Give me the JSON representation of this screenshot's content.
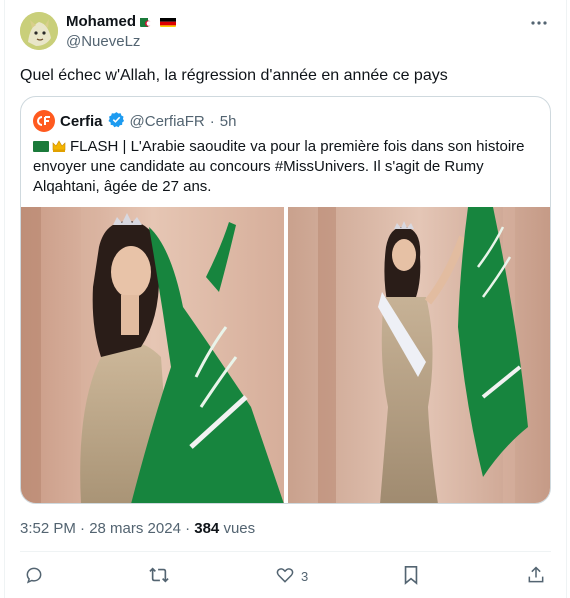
{
  "author": {
    "display_name": "Mohamed",
    "handle": "@NueveLz",
    "flags": [
      "algeria-flag",
      "germany-flag"
    ]
  },
  "tweet": {
    "text": "Quel échec w'Allah, la régression d'année en année ce pays"
  },
  "quote": {
    "display_name": "Cerfia",
    "handle": "@CerfiaFR",
    "separator": "·",
    "age": "5h",
    "verified": true,
    "text": "FLASH | L'Arabie saoudite va pour la première fois dans son histoire envoyer une candidate au concours #MissUnivers. Il s'agit de Rumy Alqahtani, âgée de 27 ans.",
    "images": [
      "woman-with-saudi-flag-seated",
      "woman-with-saudi-flag-standing-sash"
    ]
  },
  "meta": {
    "time": "3:52 PM · 28 mars 2024 · ",
    "views_count": "384",
    "views_label": " vues"
  },
  "actions": {
    "reply_count": "",
    "retweet_count": "",
    "like_count": "3",
    "bookmark_count": ""
  },
  "colors": {
    "text": "#0f1419",
    "secondary": "#536471",
    "border": "#cfd9de",
    "verified": "#1d9bf0",
    "flag_green": "#1b7a3a"
  }
}
